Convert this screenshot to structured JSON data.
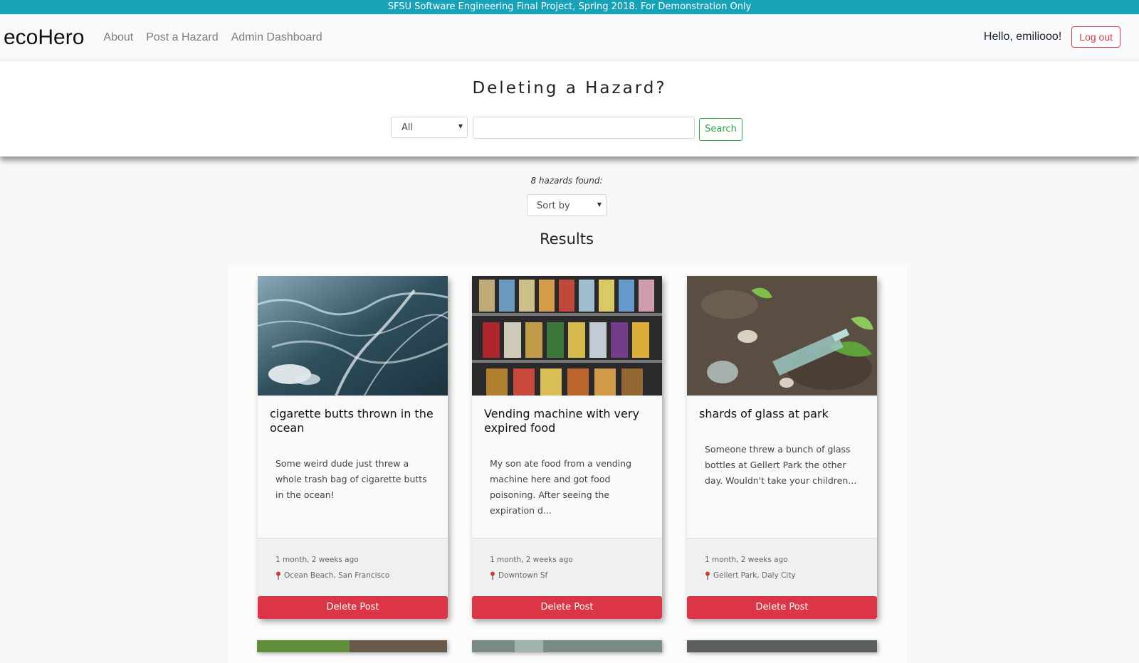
{
  "banner": {
    "text": "SFSU Software Engineering Final Project, Spring 2018. For Demonstration Only"
  },
  "nav": {
    "brand": "ecoHero",
    "links": [
      "About",
      "Post a Hazard",
      "Admin Dashboard"
    ],
    "greeting": "Hello, emiliooo!",
    "logout_label": "Log out"
  },
  "search": {
    "title": "Deleting a Hazard?",
    "category_selected": "All",
    "query_value": "",
    "button_label": "Search"
  },
  "results": {
    "count_text": "8 hazards found:",
    "sort_selected": "Sort by",
    "heading": "Results",
    "cards": [
      {
        "title": "cigarette butts thrown in the ocean",
        "description": "Some weird dude just threw a whole trash bag of cigarette butts in the ocean!",
        "time": "1 month, 2 weeks ago",
        "location": "Ocean Beach, San Francisco",
        "delete_label": "Delete Post",
        "image": "ocean-waves"
      },
      {
        "title": "Vending machine with very expired food",
        "description": "My son ate food from a vending machine here and got food poisoning. After seeing the expiration d...",
        "time": "1 month, 2 weeks ago",
        "location": "Downtown Sf",
        "delete_label": "Delete Post",
        "image": "vending-machine"
      },
      {
        "title": "shards of glass at park",
        "description": "Someone threw a bunch of glass bottles at Gellert Park the other day. Wouldn't take your children...",
        "time": "1 month, 2 weeks ago",
        "location": "Gellert Park, Daly City",
        "delete_label": "Delete Post",
        "image": "broken-glass"
      }
    ]
  },
  "colors": {
    "banner": "#17a2b8",
    "danger": "#dc3545",
    "success": "#28a745"
  }
}
